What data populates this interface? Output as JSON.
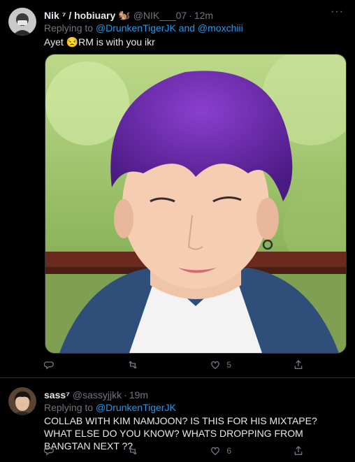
{
  "tweets": [
    {
      "name": "Nik ⁷ / hobiuary",
      "emoji": "🐿️",
      "handle": "@NIK___07",
      "time": "12m",
      "reply_prefix": "Replying to ",
      "reply_user1": "@DrunkenTigerJK",
      "reply_join": " and ",
      "reply_user2": "@moxchiii",
      "text_before": "Ayet ",
      "text_emoji": "😒",
      "text_after": "RM is with you ikr",
      "likes": "5",
      "more": "···"
    },
    {
      "name": "sass⁷",
      "handle": "@sassyjjkk",
      "time": "19m",
      "reply_prefix": "Replying to ",
      "reply_user1": "@DrunkenTigerJK",
      "text": "COLLAB WITH KIM NAMJOON? IS THIS FOR HIS MIXTAPE? WHAT ELSE DO YOU KNOW? WHATS DROPPING FROM BANGTAN NEXT ??",
      "likes": "6"
    }
  ],
  "icons": [
    "more-icon",
    "reply-icon",
    "retweet-icon",
    "like-icon",
    "share-icon"
  ],
  "colors": {
    "accent": "#1d9bf0",
    "muted": "#71767b",
    "text": "#e7e9ea",
    "bg": "#000000",
    "divider": "#2f3336"
  }
}
